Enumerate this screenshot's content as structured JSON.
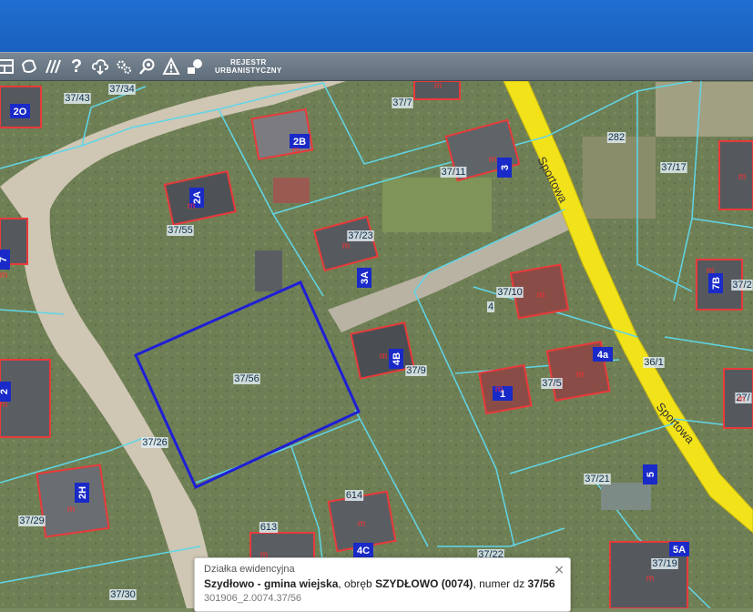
{
  "toolbar": {
    "help_glyph": "?",
    "rejestr_line1": "REJESTR",
    "rejestr_line2": "URBANISTYCZNY",
    "icons": [
      "layout-icon",
      "shape-icon",
      "hatch-icon",
      "help-icon",
      "cloud-download-icon",
      "settings-icon",
      "zoom-icon",
      "warning-icon",
      "layers-icon"
    ]
  },
  "map": {
    "selected_parcel": "37/56",
    "parcel_labels": [
      "37/43",
      "37/34",
      "37/7",
      "282",
      "37/11",
      "37/17",
      "37/55",
      "37/23",
      "37/10",
      "4",
      "37/9",
      "37/5",
      "36/1",
      "37/26",
      "37/21",
      "37/29",
      "614",
      "613",
      "37/22",
      "37/19",
      "37/30",
      "37/2",
      "27/"
    ],
    "house_numbers": [
      "2O",
      "2B",
      "3",
      "2A",
      "3A",
      "4B",
      "4a",
      "2H",
      "4C",
      "5",
      "5A",
      "1",
      "7",
      "7B",
      "2"
    ],
    "street": "Sportowa",
    "building_marker": "m",
    "colors": {
      "road": "#f2e21a",
      "selection": "#1f1fd6",
      "building_outline": "#e83a3a",
      "parcel_lines": "#5fd6e8",
      "house_number_bg": "#1a2ac8"
    }
  },
  "popup": {
    "title": "Działka ewidencyjna",
    "line_bold1": "Szydłowo - gmina wiejska",
    "line_mid1": ", obręb ",
    "line_bold2": "SZYDŁOWO (0074)",
    "line_mid2": ", numer dz ",
    "line_bold3": "37/56",
    "identifier": "301906_2.0074.37/56",
    "close_glyph": "⨯"
  }
}
